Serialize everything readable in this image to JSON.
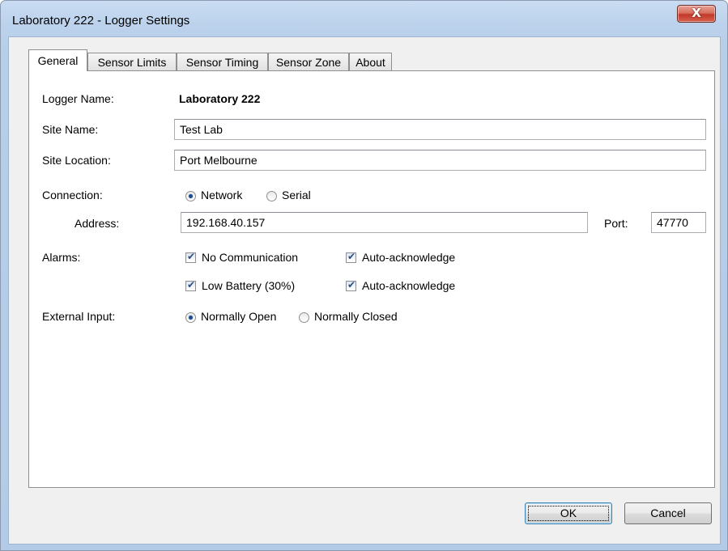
{
  "window": {
    "title": "Laboratory 222 - Logger Settings",
    "close_glyph": "X"
  },
  "tabs": [
    {
      "label": "General",
      "active": true
    },
    {
      "label": "Sensor Limits",
      "active": false
    },
    {
      "label": "Sensor Timing",
      "active": false
    },
    {
      "label": "Sensor Zone",
      "active": false
    },
    {
      "label": "About",
      "active": false
    }
  ],
  "general": {
    "logger_name_label": "Logger Name:",
    "logger_name_value": "Laboratory 222",
    "site_name_label": "Site Name:",
    "site_name_value": "Test Lab",
    "site_location_label": "Site Location:",
    "site_location_value": "Port Melbourne",
    "connection_label": "Connection:",
    "connection_options": [
      "Network",
      "Serial"
    ],
    "connection_selected": "Network",
    "address_label": "Address:",
    "address_value": "192.168.40.157",
    "port_label": "Port:",
    "port_value": "47770",
    "alarms_label": "Alarms:",
    "alarms": [
      {
        "label": "No Communication",
        "checked": true,
        "ack_label": "Auto-acknowledge",
        "ack_checked": true
      },
      {
        "label": "Low Battery (30%)",
        "checked": true,
        "ack_label": "Auto-acknowledge",
        "ack_checked": true
      }
    ],
    "external_input_label": "External Input:",
    "external_input_options": [
      "Normally Open",
      "Normally Closed"
    ],
    "external_input_selected": "Normally Open"
  },
  "buttons": {
    "ok": "OK",
    "cancel": "Cancel"
  },
  "colors": {
    "radio_dot": "#1b4e8c",
    "check_mark": "#2a4f7e",
    "close_red": "#c0392b"
  }
}
